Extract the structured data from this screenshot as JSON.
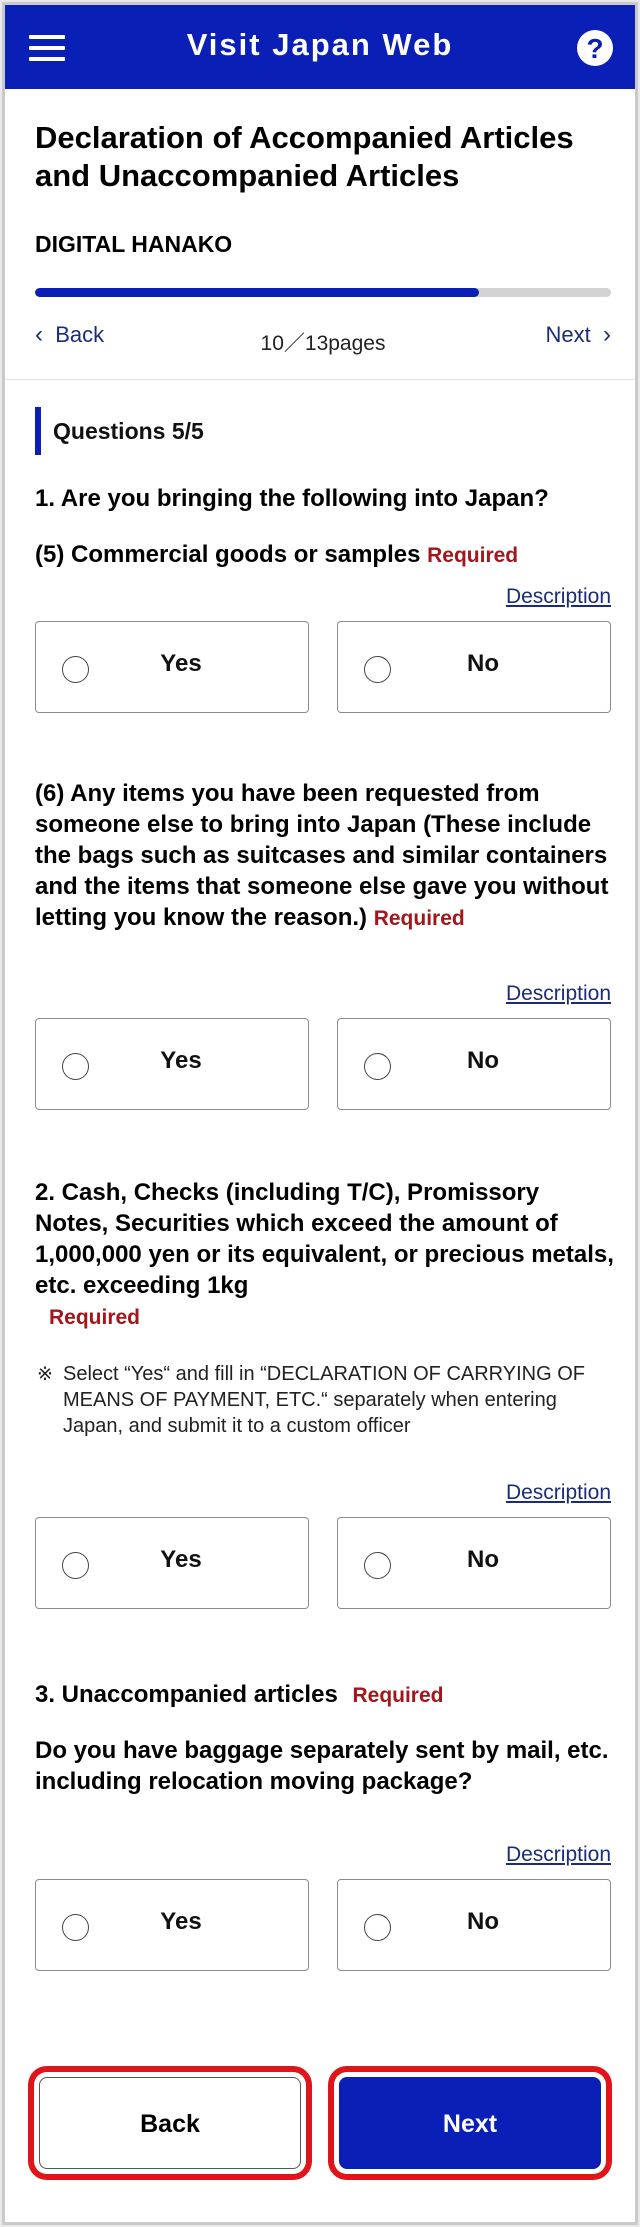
{
  "header": {
    "title": "Visit Japan Web",
    "help_glyph": "?",
    "menu_icon": "hamburger-menu-icon",
    "help_icon": "question-mark-icon",
    "brand_color": "#0a1fb5"
  },
  "page": {
    "title": "Declaration of Accompanied Articles and Unaccompanied Articles",
    "user_name": "DIGITAL HANAKO"
  },
  "progress": {
    "fraction": 0.77,
    "back_label": "Back",
    "next_label": "Next",
    "page_count": "10／13pages"
  },
  "section": {
    "heading": "Questions 5/5"
  },
  "questions": {
    "q1_heading": "1. Are you bringing the following into Japan?",
    "q1_5": {
      "text": "(5) Commercial goods or samples",
      "required": "Required",
      "description": "Description",
      "yes": "Yes",
      "no": "No"
    },
    "q1_6": {
      "text": "(6) Any items you have been requested from someone else to bring into Japan (These include the bags such as suitcases and similar containers and the items that someone else gave you without letting you know the reason.)",
      "required": "Required",
      "description": "Description",
      "yes": "Yes",
      "no": "No"
    },
    "q2": {
      "text": "2. Cash, Checks (including T/C), Promissory Notes, Securities which exceed the amount of 1,000,000 yen or its equivalent, or precious metals, etc. exceeding 1kg",
      "required": "Required",
      "note_mark": "※",
      "note": "Select “Yes“ and fill in “DECLARATION OF CARRYING OF MEANS OF PAYMENT, ETC.“ separately when entering Japan, and submit it to a custom officer",
      "description": "Description",
      "yes": "Yes",
      "no": "No"
    },
    "q3": {
      "heading": "3. Unaccompanied articles",
      "required": "Required",
      "text": "Do you have baggage separately sent by mail, etc. including relocation moving package?",
      "description": "Description",
      "yes": "Yes",
      "no": "No"
    }
  },
  "footer": {
    "back_label": "Back",
    "next_label": "Next",
    "highlight_color": "#e0141b"
  }
}
